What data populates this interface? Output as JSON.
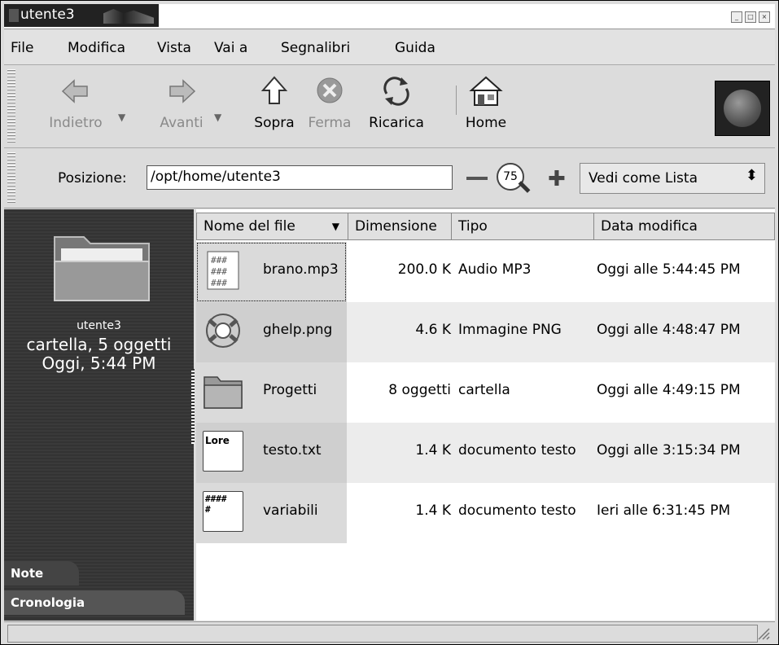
{
  "window": {
    "title": "utente3"
  },
  "menubar": [
    "File",
    "Modifica",
    "Vista",
    "Vai a",
    "Segnalibri",
    "Guida"
  ],
  "toolbar": {
    "back": "Indietro",
    "forward": "Avanti",
    "up": "Sopra",
    "stop": "Ferma",
    "reload": "Ricarica",
    "home": "Home"
  },
  "location": {
    "label": "Posizione:",
    "value": "/opt/home/utente3"
  },
  "zoom": {
    "level": "75"
  },
  "view": {
    "selected": "Vedi come Lista"
  },
  "sidebar": {
    "folder_name": "utente3",
    "info_line1": "cartella, 5 oggetti",
    "info_line2": "Oggi, 5:44 PM",
    "tabs": [
      "Note",
      "Cronologia"
    ]
  },
  "columns": [
    "Nome del file",
    "Dimensione",
    "Tipo",
    "Data modifica"
  ],
  "files": [
    {
      "name": "brano.mp3",
      "size": "200.0 K",
      "type": "Audio MP3",
      "date": "Oggi alle 5:44:45 PM",
      "icon": "audio-file-icon"
    },
    {
      "name": "ghelp.png",
      "size": "4.6 K",
      "type": "Immagine PNG",
      "date": "Oggi alle 4:48:47 PM",
      "icon": "lifebuoy-icon"
    },
    {
      "name": "Progetti",
      "size": "8 oggetti",
      "type": "cartella",
      "date": "Oggi alle 4:49:15 PM",
      "icon": "folder-icon"
    },
    {
      "name": "testo.txt",
      "size": "1.4 K",
      "type": "documento testo",
      "date": "Oggi alle 3:15:34 PM",
      "icon": "text-file-icon",
      "preview": "Lore"
    },
    {
      "name": "variabili",
      "size": "1.4 K",
      "type": "documento testo",
      "date": "Ieri alle 6:31:45 PM",
      "icon": "text-file-icon",
      "preview": "####\n#"
    }
  ]
}
